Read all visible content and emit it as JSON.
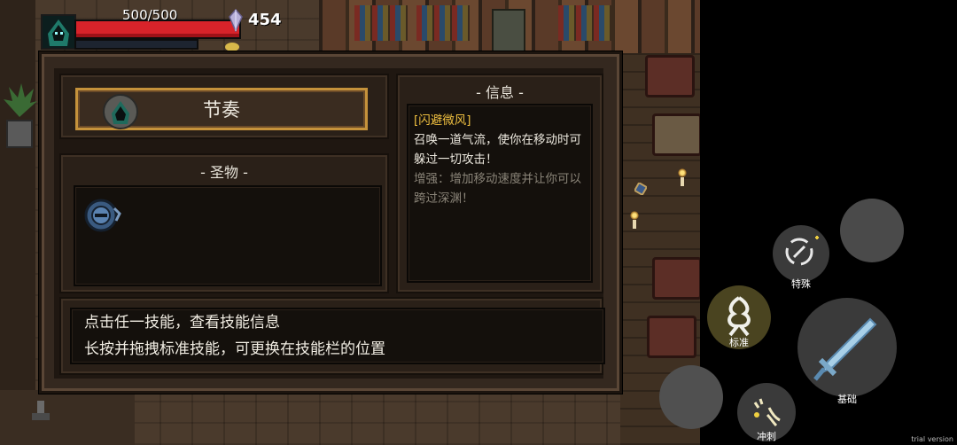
{
  "hud": {
    "hp_text": "500/500",
    "hp_fraction": 1.0,
    "gem_count": "454",
    "colors": {
      "hp": "#d8232a",
      "gem": "#b8b0d8"
    }
  },
  "panel": {
    "skill_title": "节奏",
    "relic_section_title": "- 圣物 -",
    "info_section_title": "- 信息 -",
    "info": {
      "name": "[闪避微风]",
      "description": "召唤一道气流，使你在移动时可躲过一切攻击！",
      "upgrade": "增强：增加移动速度并让你可以跨过深渊！"
    },
    "tips": [
      "点击任一技能，查看技能信息",
      "长按并拖拽标准技能，可更换在技能栏的位置"
    ],
    "colors": {
      "accent_gold": "#c5923b",
      "info_name": "#f0c040"
    }
  },
  "controls": {
    "special_label": "特殊",
    "standard_label": "标准",
    "basic_label": "基础",
    "dash_label": "冲刺"
  },
  "watermark": "trial version"
}
